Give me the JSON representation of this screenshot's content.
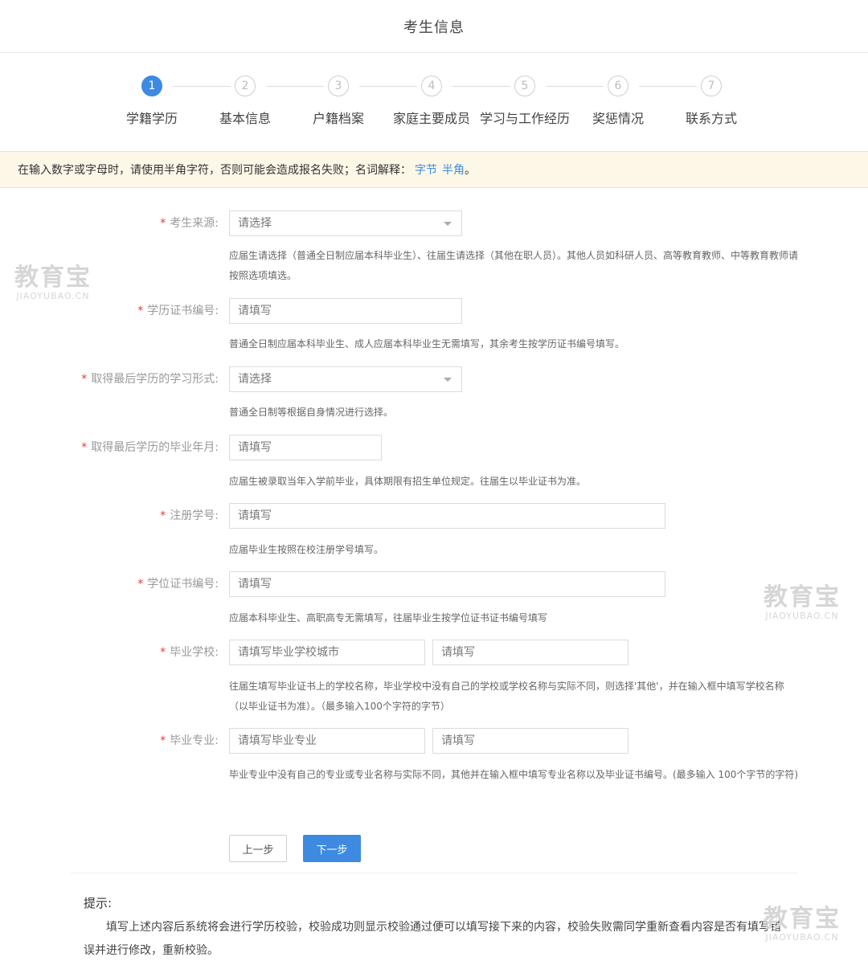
{
  "page": {
    "title": "考生信息"
  },
  "steps": [
    {
      "num": "1",
      "label": "学籍学历"
    },
    {
      "num": "2",
      "label": "基本信息"
    },
    {
      "num": "3",
      "label": "户籍档案"
    },
    {
      "num": "4",
      "label": "家庭主要成员"
    },
    {
      "num": "5",
      "label": "学习与工作经历"
    },
    {
      "num": "6",
      "label": "奖惩情况"
    },
    {
      "num": "7",
      "label": "联系方式"
    }
  ],
  "notice": {
    "text": "在输入数字或字母时，请使用半角字符，否则可能会造成报名失败；名词解释：",
    "link1": "字节",
    "link2": "半角",
    "end": "。"
  },
  "form": {
    "required_mark": "*",
    "source": {
      "label": "考生来源:",
      "value": "请选择",
      "hint": "应届生请选择（普通全日制应届本科毕业生）、往届生请选择（其他在职人员）。其他人员如科研人员、高等教育教师、中等教育教师请按照选项填选。"
    },
    "cert_no": {
      "label": "学历证书编号:",
      "placeholder": "请填写",
      "hint": "普通全日制应届本科毕业生、成人应届本科毕业生无需填写，其余考生按学历证书编号填写。"
    },
    "study_form": {
      "label": "取得最后学历的学习形式:",
      "value": "请选择",
      "hint": "普通全日制等根据自身情况进行选择。"
    },
    "grad_date": {
      "label": "取得最后学历的毕业年月:",
      "placeholder": "请填写",
      "hint": "应届生被录取当年入学前毕业，具体期限有招生单位规定。往届生以毕业证书为准。"
    },
    "reg_no": {
      "label": "注册学号:",
      "placeholder": "请填写",
      "hint": "应届毕业生按照在校注册学号填写。"
    },
    "degree_no": {
      "label": "学位证书编号:",
      "placeholder": "请填写",
      "hint": "应届本科毕业生、高职高专无需填写，往届毕业生按学位证书证书编号填写"
    },
    "school": {
      "label": "毕业学校:",
      "placeholder_city": "请填写毕业学校城市",
      "placeholder": "请填写",
      "hint": "往届生填写毕业证书上的学校名称，毕业学校中没有自己的学校或学校名称与实际不同，则选择'其他'，并在输入框中填写学校名称（以毕业证书为准）。（最多输入100个字符的字节）"
    },
    "major": {
      "label": "毕业专业:",
      "placeholder_major": "请填写毕业专业",
      "placeholder": "请填写",
      "hint": "毕业专业中没有自己的专业或专业名称与实际不同，其他并在输入框中填写专业名称以及毕业证书编号。(最多输入 100个字节的字符)"
    }
  },
  "buttons": {
    "prev": "上一步",
    "next": "下一步"
  },
  "tips": {
    "title": "提示:",
    "body": "填写上述内容后系统将会进行学历校验，校验成功则显示校验通过便可以填写接下来的内容，校验失败需同学重新查看内容是否有填写错误并进行修改，重新校验。"
  },
  "watermark": {
    "logo": "教育宝",
    "domain": "JIAOYUBAO.CN"
  },
  "colors": {
    "accent": "#3d8ae0",
    "required": "#e4393c",
    "notice_bg": "#fdf7e8"
  }
}
